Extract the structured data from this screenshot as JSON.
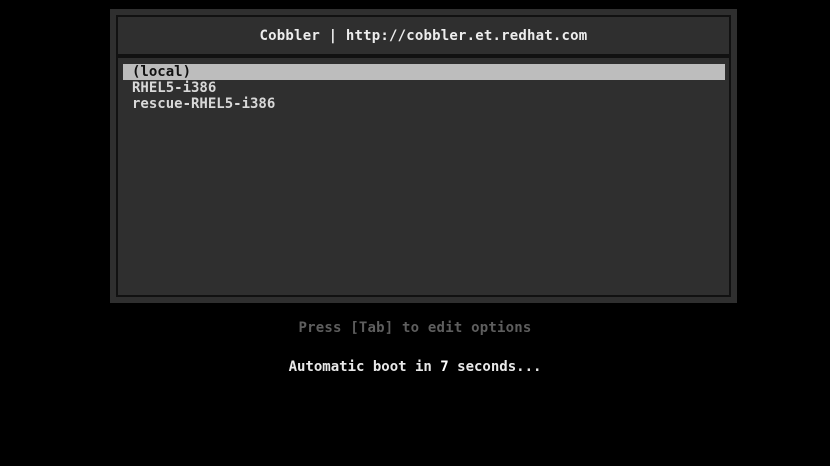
{
  "title": "Cobbler | http://cobbler.et.redhat.com",
  "menu": {
    "items": [
      {
        "label": "(local)",
        "selected": true
      },
      {
        "label": "RHEL5-i386",
        "selected": false
      },
      {
        "label": "rescue-RHEL5-i386",
        "selected": false
      }
    ]
  },
  "hint": "Press [Tab] to edit options",
  "countdown": {
    "prefix": "Automatic boot in ",
    "seconds": "7",
    "suffix": " seconds..."
  },
  "colors": {
    "background": "#000000",
    "panel": "#2f2f2f",
    "selection": "#bdbdbd",
    "hint_text": "#5e5e5e"
  }
}
